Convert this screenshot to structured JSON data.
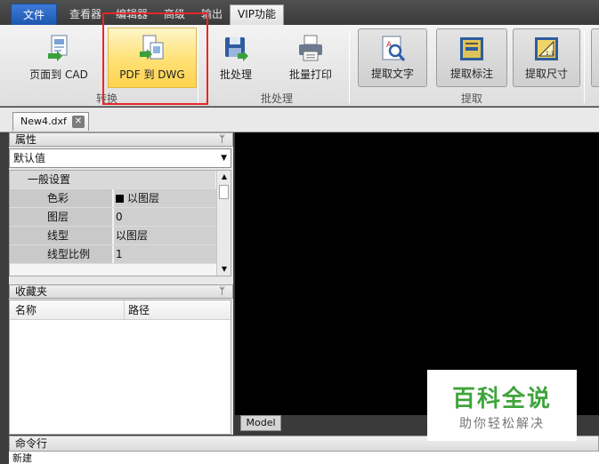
{
  "menu": {
    "tabs": [
      "文件",
      "查看器",
      "编辑器",
      "高级",
      "输出",
      "VIP功能"
    ]
  },
  "ribbon": {
    "buttons": [
      {
        "label": "页面到 CAD",
        "icon": "page-to-cad-icon"
      },
      {
        "label": "PDF 到 DWG",
        "icon": "pdf-to-dwg-icon"
      },
      {
        "label": "批处理",
        "icon": "batch-process-icon"
      },
      {
        "label": "批量打印",
        "icon": "batch-print-icon"
      },
      {
        "label": "提取文字",
        "icon": "extract-text-icon"
      },
      {
        "label": "提取标注",
        "icon": "extract-dimension-icon"
      },
      {
        "label": "提取尺寸",
        "icon": "extract-size-icon"
      }
    ],
    "groups": [
      "转换",
      "批处理",
      "提取"
    ]
  },
  "document": {
    "tab_label": "New4.dxf",
    "close": "✕"
  },
  "properties": {
    "title": "属性",
    "pin": "ᛘ",
    "combo_value": "默认值",
    "section": "一般设置",
    "section_toggle": "−",
    "rows": [
      {
        "key": "色彩",
        "value": "以图层"
      },
      {
        "key": "图层",
        "value": "0"
      },
      {
        "key": "线型",
        "value": "以图层"
      },
      {
        "key": "线型比例",
        "value": "1"
      }
    ]
  },
  "favorites": {
    "title": "收藏夹",
    "pin": "ᛘ",
    "col_name": "名称",
    "col_path": "路径"
  },
  "model_tab": "Model",
  "command": {
    "title": "命令行",
    "line": "新建"
  },
  "watermark": {
    "title": "百科全说",
    "subtitle": "助你轻松解决"
  }
}
